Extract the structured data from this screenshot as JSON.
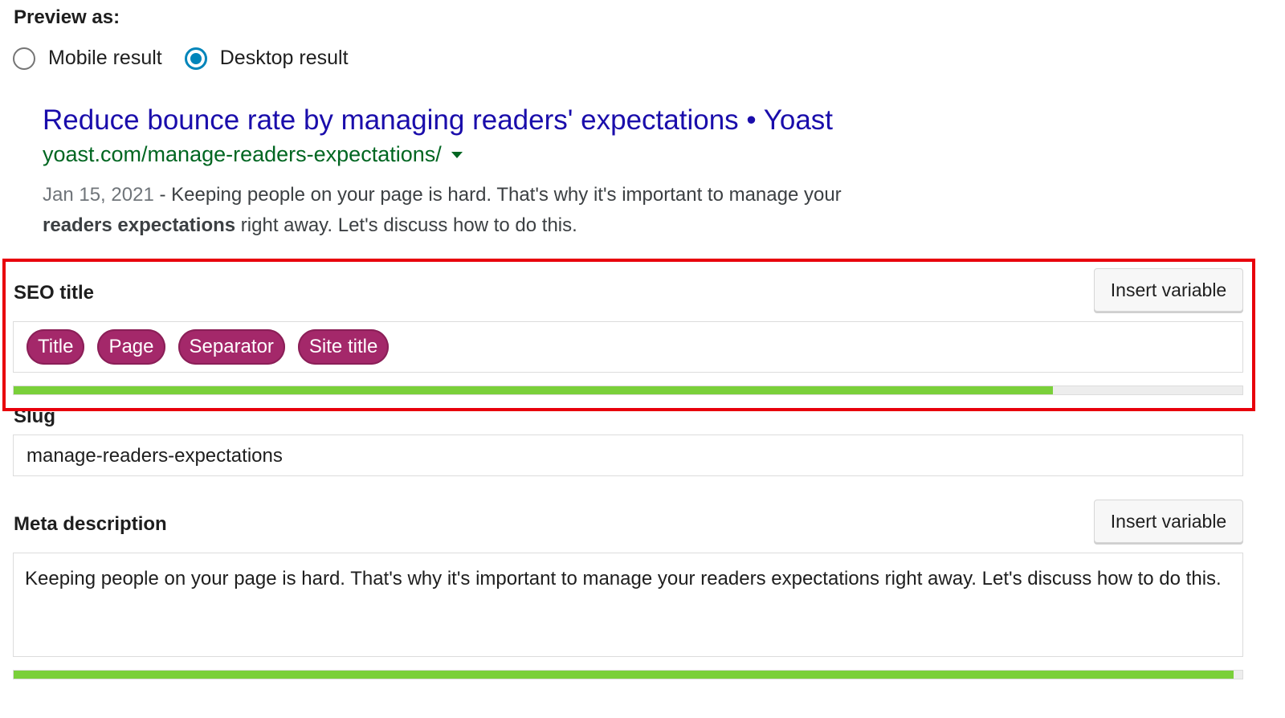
{
  "preview": {
    "label": "Preview as:",
    "options": [
      {
        "label": "Mobile result",
        "checked": false
      },
      {
        "label": "Desktop result",
        "checked": true
      }
    ]
  },
  "serp": {
    "title": "Reduce bounce rate by managing readers' expectations • Yoast",
    "url": "yoast.com/manage-readers-expectations/",
    "date": "Jan 15, 2021",
    "desc_part1": " - Keeping people on your page is hard. That's why it's important to manage your",
    "desc_bold": "readers expectations",
    "desc_part2": " right away. Let's discuss how to do this."
  },
  "seo_title": {
    "label": "SEO title",
    "insert_button": "Insert variable",
    "tags": [
      "Title",
      "Page",
      "Separator",
      "Site title"
    ],
    "progress": 0.846
  },
  "slug": {
    "label": "Slug",
    "value": "manage-readers-expectations"
  },
  "meta_description": {
    "label": "Meta description",
    "insert_button": "Insert variable",
    "value": "Keeping people on your page is hard. That's why it's important to manage your readers expectations right away. Let's discuss how to do this.",
    "progress": 0.993
  },
  "colors": {
    "accent": "#0085ba",
    "tag": "#a4286a",
    "progress_good": "#7ad03a",
    "highlight": "#e8000c",
    "serp_title": "#1a0dab",
    "serp_url": "#006621"
  }
}
